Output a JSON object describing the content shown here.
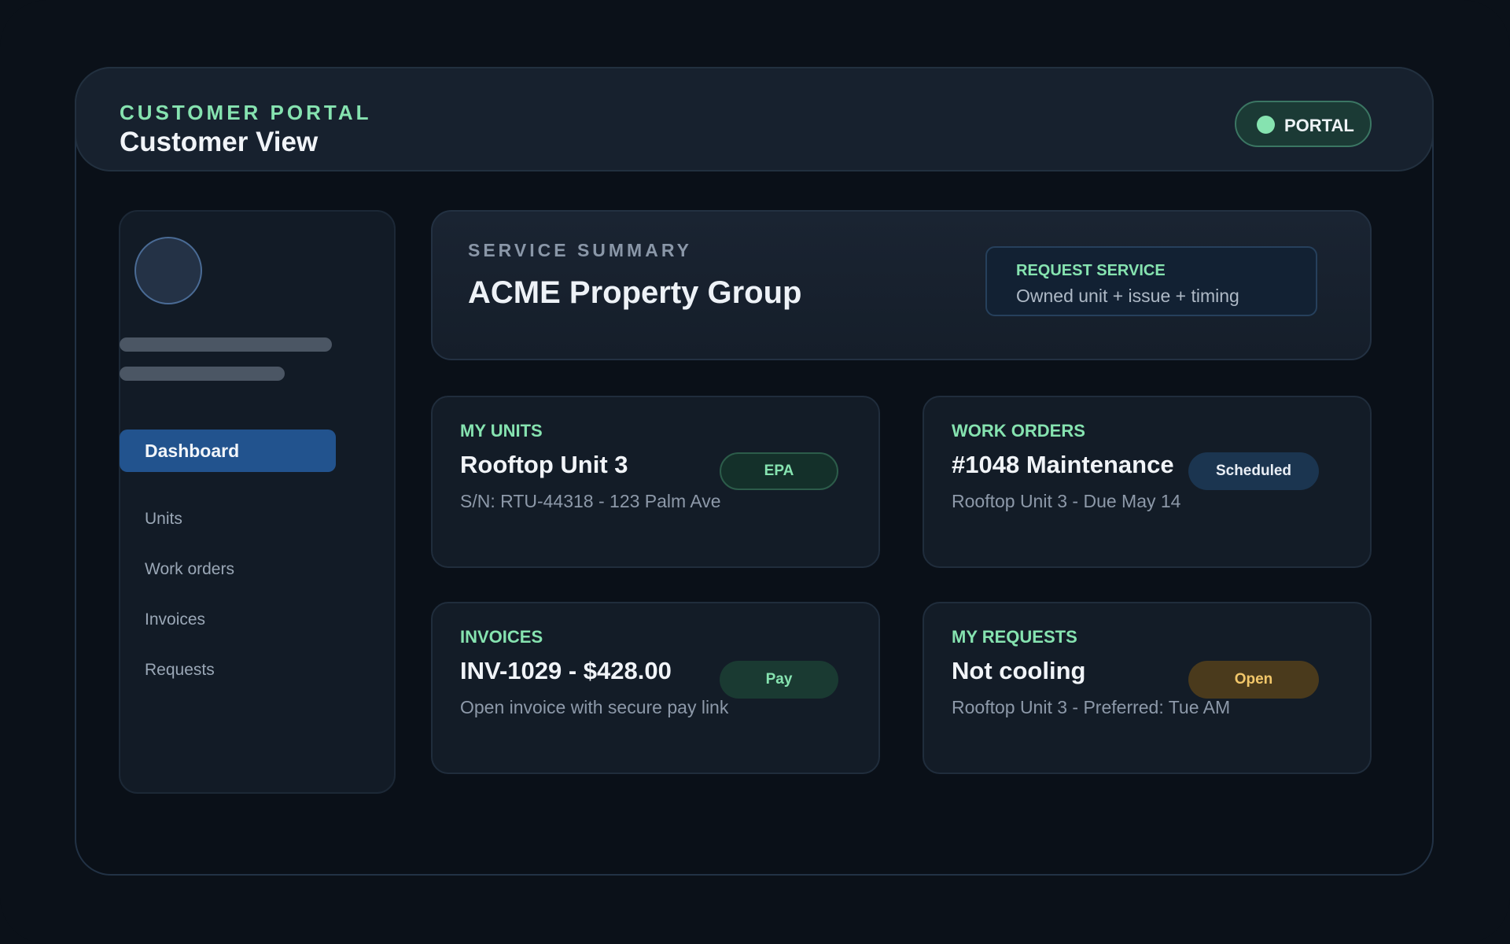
{
  "header": {
    "eyebrow": "CUSTOMER PORTAL",
    "title": "Customer View",
    "portal_badge": "PORTAL"
  },
  "sidebar": {
    "active_item": "Dashboard",
    "items": [
      "Units",
      "Work orders",
      "Invoices",
      "Requests"
    ]
  },
  "summary": {
    "eyebrow": "SERVICE SUMMARY",
    "title": "ACME Property Group",
    "request": {
      "label": "REQUEST SERVICE",
      "description": "Owned unit + issue + timing"
    }
  },
  "cards": {
    "units": {
      "eyebrow": "MY UNITS",
      "title": "Rooftop Unit 3",
      "sub": "S/N: RTU-44318 - 123 Palm Ave",
      "badge": "EPA"
    },
    "work_orders": {
      "eyebrow": "WORK ORDERS",
      "title": "#1048 Maintenance",
      "sub": "Rooftop Unit 3 - Due May 14",
      "badge": "Scheduled"
    },
    "invoices": {
      "eyebrow": "INVOICES",
      "title": "INV-1029 - $428.00",
      "sub": "Open invoice with secure pay link",
      "badge": "Pay"
    },
    "requests": {
      "eyebrow": "MY REQUESTS",
      "title": "Not cooling",
      "sub": "Rooftop Unit 3 - Preferred: Tue AM",
      "badge": "Open"
    }
  },
  "colors": {
    "accent_green": "#86e3b0",
    "active_nav": "#22538e",
    "open_badge": "#f2c76a",
    "background": "#0b1119"
  }
}
